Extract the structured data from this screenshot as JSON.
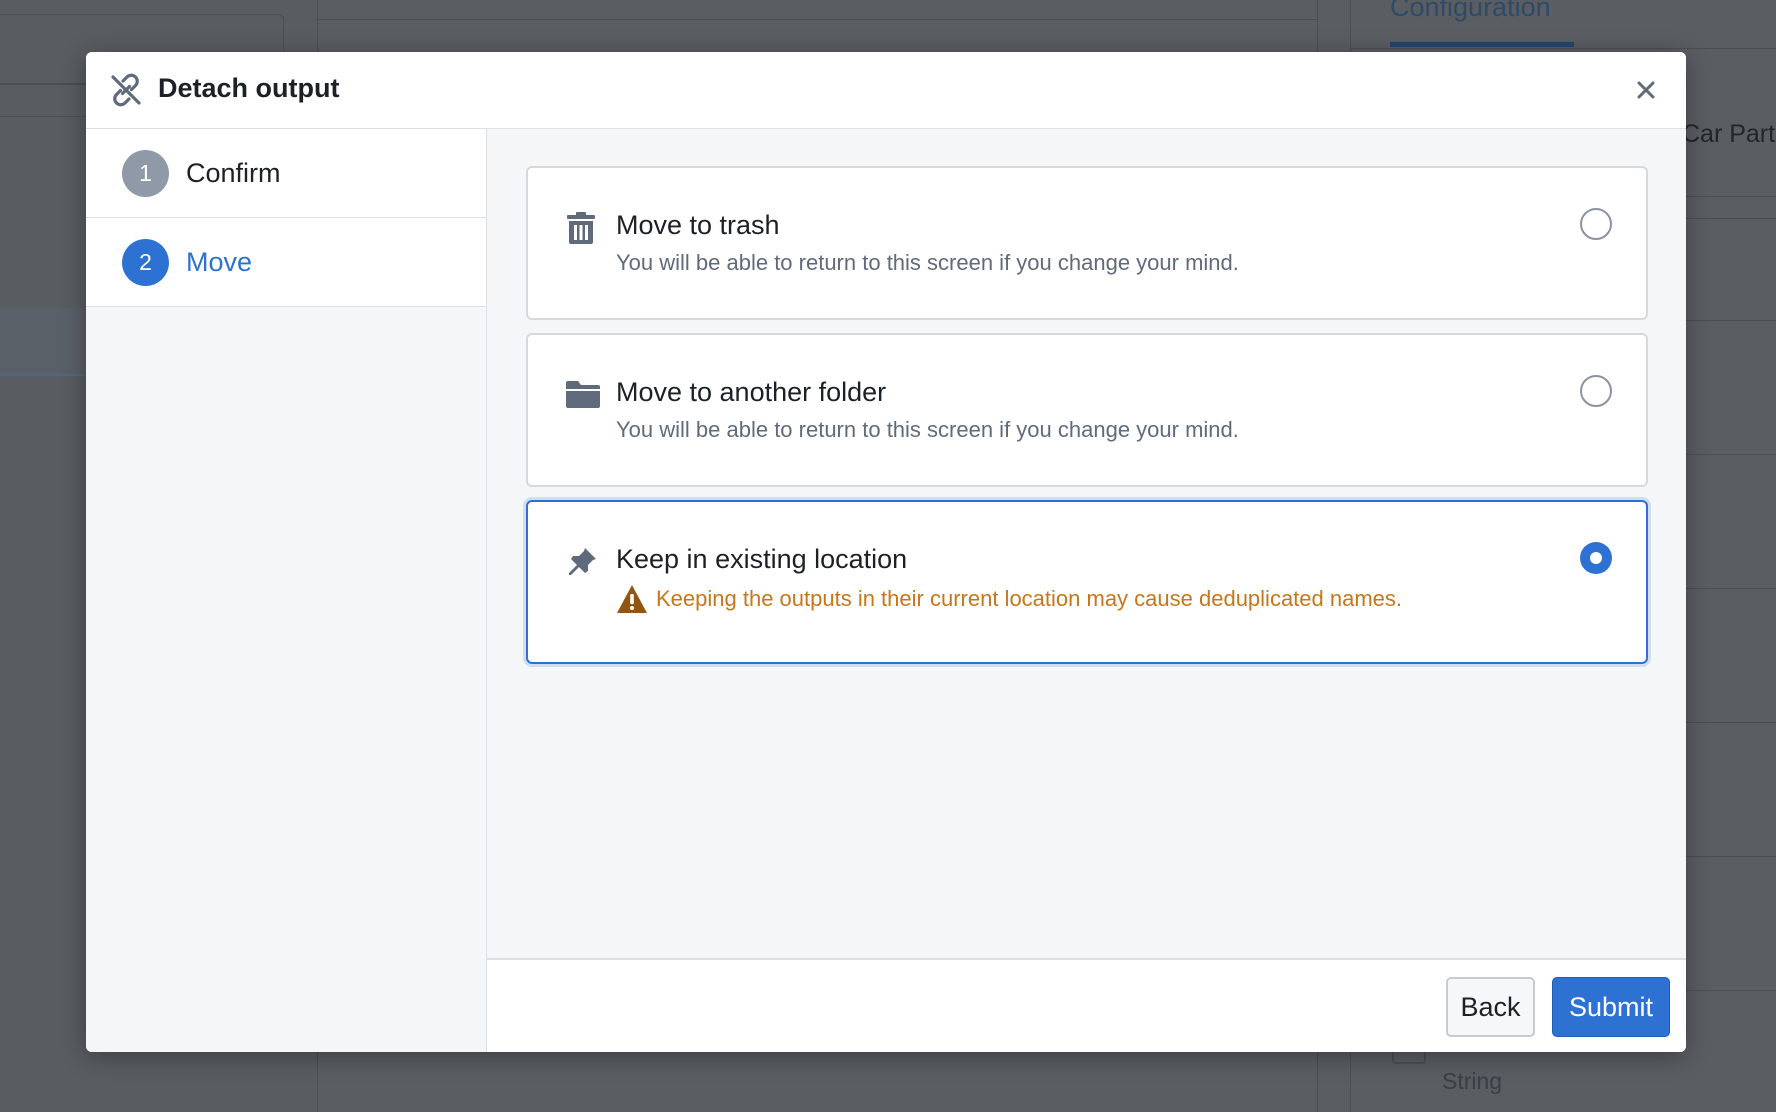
{
  "background": {
    "tab_label": "Configuration",
    "right_text": "Car Part",
    "string_label": "String"
  },
  "dialog": {
    "title": "Detach output",
    "header_icon": "unlink-icon",
    "close_icon": "close-icon"
  },
  "steps": [
    {
      "number": "1",
      "label": "Confirm",
      "state": "complete"
    },
    {
      "number": "2",
      "label": "Move",
      "state": "active"
    }
  ],
  "options": [
    {
      "icon": "trash-icon",
      "title": "Move to trash",
      "description": "You will be able to return to this screen if you change your mind.",
      "selected": false
    },
    {
      "icon": "folder-icon",
      "title": "Move to another folder",
      "description": "You will be able to return to this screen if you change your mind.",
      "selected": false
    },
    {
      "icon": "pin-icon",
      "title": "Keep in existing location",
      "warning": "Keeping the outputs in their current location may cause deduplicated names.",
      "warning_icon": "warning-triangle-icon",
      "selected": true
    }
  ],
  "footer": {
    "back_label": "Back",
    "submit_label": "Submit"
  },
  "colors": {
    "primary": "#2d72d2",
    "warning": "#c87619",
    "muted_step": "#8f99a8"
  }
}
